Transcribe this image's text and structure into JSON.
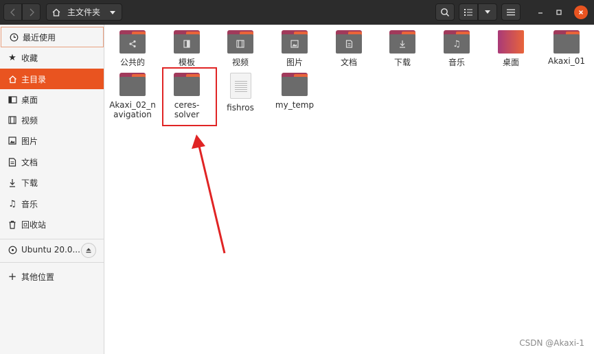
{
  "window": {
    "path_label": "主文件夹",
    "icons": {
      "back": "chevron-left-icon",
      "forward": "chevron-right-icon",
      "home": "home-icon",
      "search": "search-icon",
      "view": "list-view-icon",
      "menu": "hamburger-menu-icon",
      "minimize": "minimize-icon",
      "maximize": "maximize-icon",
      "close": "close-icon"
    }
  },
  "sidebar": {
    "items": [
      {
        "label": "最近使用",
        "icon": "clock-icon"
      },
      {
        "label": "收藏",
        "icon": "star-icon"
      },
      {
        "label": "主目录",
        "icon": "home-icon"
      },
      {
        "label": "桌面",
        "icon": "desktop-icon"
      },
      {
        "label": "视频",
        "icon": "video-icon"
      },
      {
        "label": "图片",
        "icon": "image-icon"
      },
      {
        "label": "文档",
        "icon": "document-icon"
      },
      {
        "label": "下载",
        "icon": "download-icon"
      },
      {
        "label": "音乐",
        "icon": "music-icon"
      },
      {
        "label": "回收站",
        "icon": "trash-icon"
      }
    ],
    "device": {
      "label": "Ubuntu 20.0...",
      "icon": "disc-icon"
    },
    "other": {
      "label": "其他位置",
      "icon": "plus-icon"
    }
  },
  "files": [
    {
      "name": "公共的",
      "type": "folder",
      "emblem": "share-icon"
    },
    {
      "name": "模板",
      "type": "folder",
      "emblem": "template-icon"
    },
    {
      "name": "视频",
      "type": "folder",
      "emblem": "video-icon"
    },
    {
      "name": "图片",
      "type": "folder",
      "emblem": "image-icon"
    },
    {
      "name": "文档",
      "type": "folder",
      "emblem": "document-icon"
    },
    {
      "name": "下载",
      "type": "folder",
      "emblem": "download-icon"
    },
    {
      "name": "音乐",
      "type": "folder",
      "emblem": "music-icon"
    },
    {
      "name": "桌面",
      "type": "folder-desktop",
      "emblem": ""
    },
    {
      "name": "Akaxi_01",
      "type": "folder",
      "emblem": ""
    },
    {
      "name": "Akaxi_02_navigation",
      "type": "folder",
      "emblem": ""
    },
    {
      "name": "ceres-solver",
      "type": "folder",
      "emblem": ""
    },
    {
      "name": "fishros",
      "type": "file",
      "emblem": ""
    },
    {
      "name": "my_temp",
      "type": "folder",
      "emblem": ""
    }
  ],
  "watermark": "CSDN @Akaxi-1",
  "colors": {
    "accent": "#e95420",
    "annotation": "#e02424"
  }
}
